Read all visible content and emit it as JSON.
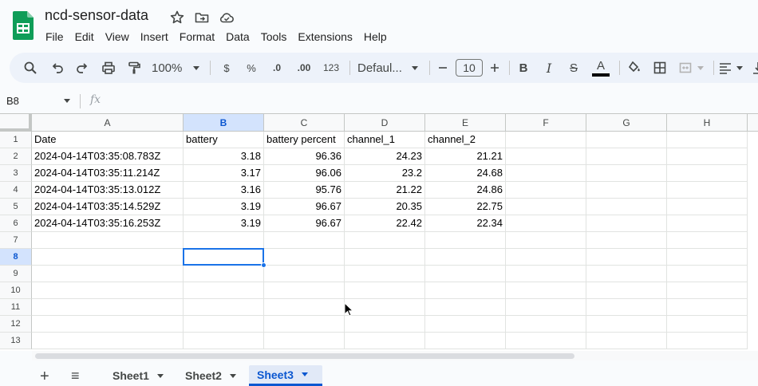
{
  "doc": {
    "title": "ncd-sensor-data"
  },
  "menu": [
    "File",
    "Edit",
    "View",
    "Insert",
    "Format",
    "Data",
    "Tools",
    "Extensions",
    "Help"
  ],
  "toolbar": {
    "zoom": "100%",
    "currency": "$",
    "percent": "%",
    "dec_decrease": ".0",
    "dec_increase": ".00",
    "number_format": "123",
    "font": "Defaul...",
    "font_size": "10",
    "bold": "B",
    "italic": "I",
    "strike": "S",
    "text_color": "A"
  },
  "formula_bar": {
    "cell_ref": "B8",
    "fx": "fx",
    "value": ""
  },
  "columns": [
    "A",
    "B",
    "C",
    "D",
    "E",
    "F",
    "G",
    "H"
  ],
  "rows": [
    "1",
    "2",
    "3",
    "4",
    "5",
    "6",
    "7",
    "8",
    "9",
    "10",
    "11",
    "12",
    "13"
  ],
  "selected": {
    "column": "B",
    "row": "8"
  },
  "cells": [
    [
      "Date",
      "battery",
      "battery percent",
      "channel_1",
      "channel_2"
    ],
    [
      "2024-04-14T03:35:08.783Z",
      "3.18",
      "96.36",
      "24.23",
      "21.21"
    ],
    [
      "2024-04-14T03:35:11.214Z",
      "3.17",
      "96.06",
      "23.2",
      "24.68"
    ],
    [
      "2024-04-14T03:35:13.012Z",
      "3.16",
      "95.76",
      "21.22",
      "24.86"
    ],
    [
      "2024-04-14T03:35:14.529Z",
      "3.19",
      "96.67",
      "20.35",
      "22.75"
    ],
    [
      "2024-04-14T03:35:16.253Z",
      "3.19",
      "96.67",
      "22.42",
      "22.34"
    ]
  ],
  "sheets": {
    "add": "+",
    "all": "≡",
    "tabs": [
      "Sheet1",
      "Sheet2",
      "Sheet3"
    ],
    "active": "Sheet3"
  },
  "colors": {
    "accent": "#1a73e8",
    "selected_header": "#d3e3fd",
    "toolbar_bg": "#edf2fa",
    "logo_green": "#0f9d58"
  }
}
